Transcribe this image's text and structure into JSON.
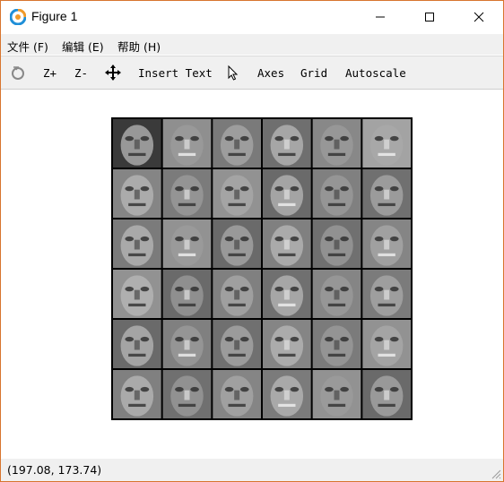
{
  "window": {
    "title": "Figure 1",
    "icon": "octave-logo-icon",
    "controls": [
      "minimize-icon",
      "maximize-icon",
      "close-icon"
    ]
  },
  "menu": {
    "file": "文件 (F)",
    "edit": "编辑 (E)",
    "help": "帮助 (H)"
  },
  "toolbar": {
    "rotate_icon": "rotate-icon",
    "zoom_in": "Z+",
    "zoom_out": "Z-",
    "pan_icon": "pan-arrows-icon",
    "insert_text": "Insert Text",
    "select_icon": "pointer-icon",
    "axes": "Axes",
    "grid": "Grid",
    "autoscale": "Autoscale"
  },
  "figure": {
    "description_type": "image grid",
    "rows": 6,
    "cols": 6,
    "content": "grayscale eigenface-like patches"
  },
  "status": {
    "coordinates": "(197.08, 173.74)"
  },
  "colors": {
    "window_border": "#d8752f",
    "bar_background": "#f0f0f0",
    "canvas": "#ffffff"
  }
}
